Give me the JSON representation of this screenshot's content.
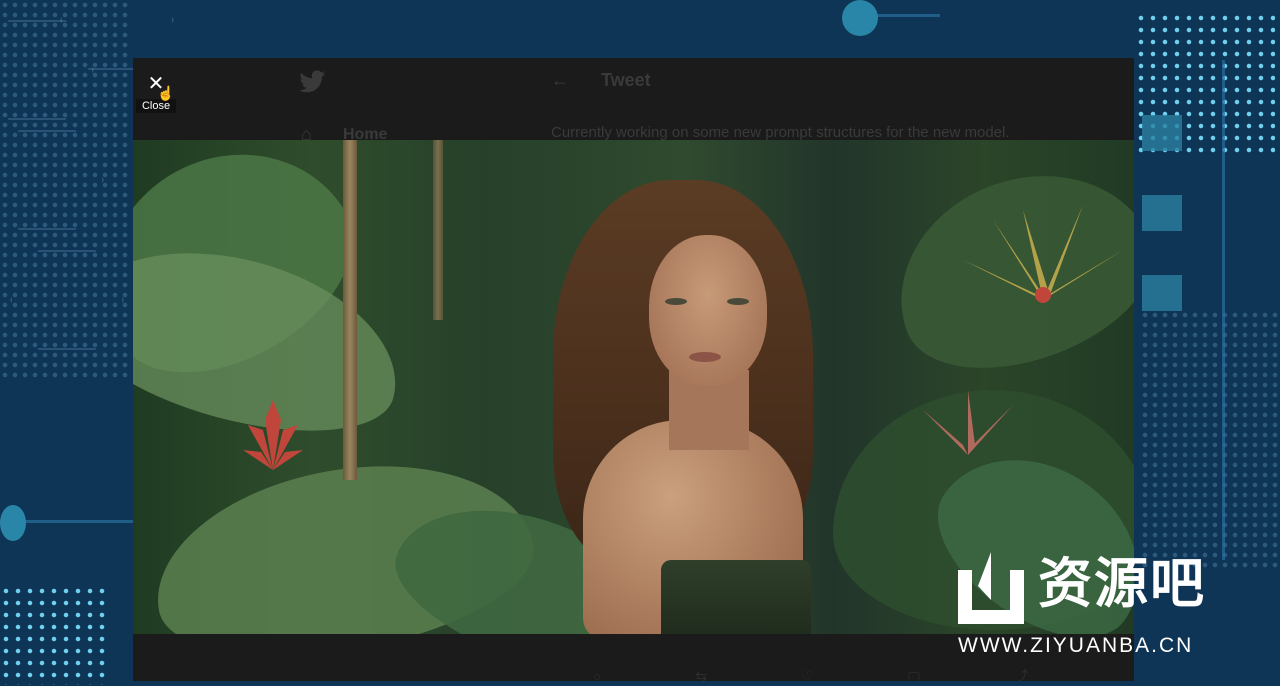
{
  "modal": {
    "close_icon": "close-icon",
    "close_label": "Close"
  },
  "tweet": {
    "page_title": "Tweet",
    "back_icon": "arrow-left-icon",
    "nav_home": "Home",
    "text": "Currently working on some new prompt structures for the new model."
  },
  "photo": {
    "subject": "woman in tropical jungle"
  },
  "watermark": {
    "name": "资源吧",
    "url": "WWW.ZIYUANBA.CN"
  },
  "colors": {
    "background": "#0f3556",
    "modal": "#1a1a1a",
    "accent_dots": "#6fd0f0"
  }
}
